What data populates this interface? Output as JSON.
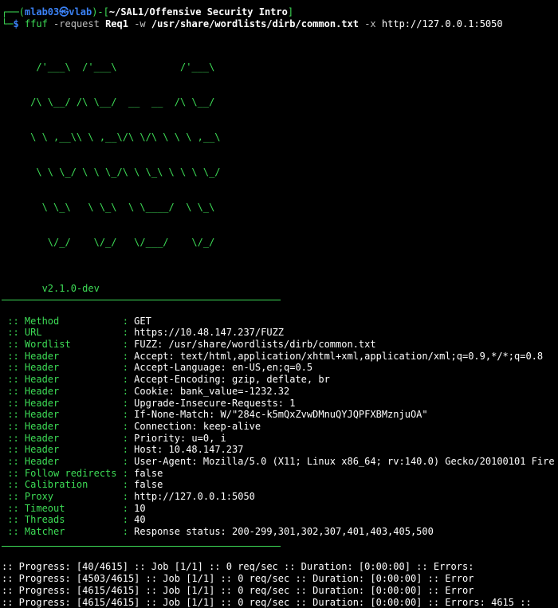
{
  "prompt": {
    "corner_top": "┌──(",
    "user": "mlab03",
    "at": "㉿",
    "host": "vlab",
    "mid": ")-[",
    "path": "~/SAL1/Offensive Security Intro",
    "end": "]",
    "corner_bottom": "└─",
    "dollar": "$"
  },
  "command": {
    "tool": "ffuf",
    "flag_request": " -request ",
    "request_value": "Req1",
    "flag_w": " -w ",
    "wordlist": "/usr/share/wordlists/dirb/common.txt",
    "flag_x": " -x ",
    "proxy": "http://127.0.0.1:5050"
  },
  "banner": [
    "      /'___\\  /'___\\           /'___\\",
    "     /\\ \\__/ /\\ \\__/  __  __  /\\ \\__/",
    "     \\ \\ ,__\\\\ \\ ,__\\/\\ \\/\\ \\ \\ \\ ,__\\",
    "      \\ \\ \\_/ \\ \\ \\_/\\ \\ \\_\\ \\ \\ \\ \\_/",
    "       \\ \\_\\   \\ \\_\\  \\ \\____/  \\ \\_\\",
    "        \\/_/    \\/_/   \\/___/    \\/_/"
  ],
  "version": "       v2.1.0-dev",
  "config": [
    {
      "key": " :: Method           : ",
      "value": "GET"
    },
    {
      "key": " :: URL              : ",
      "value": "https://10.48.147.237/FUZZ"
    },
    {
      "key": " :: Wordlist         : ",
      "value": "FUZZ: /usr/share/wordlists/dirb/common.txt"
    },
    {
      "key": " :: Header           : ",
      "value": "Accept: text/html,application/xhtml+xml,application/xml;q=0.9,*/*;q=0.8"
    },
    {
      "key": " :: Header           : ",
      "value": "Accept-Language: en-US,en;q=0.5"
    },
    {
      "key": " :: Header           : ",
      "value": "Accept-Encoding: gzip, deflate, br"
    },
    {
      "key": " :: Header           : ",
      "value": "Cookie: bank_value=-1232.32"
    },
    {
      "key": " :: Header           : ",
      "value": "Upgrade-Insecure-Requests: 1"
    },
    {
      "key": " :: Header           : ",
      "value": "If-None-Match: W/\"284c-k5mQxZvwDMnuQYJQPFXBMznjuOA\""
    },
    {
      "key": " :: Header           : ",
      "value": "Connection: keep-alive"
    },
    {
      "key": " :: Header           : ",
      "value": "Priority: u=0, i"
    },
    {
      "key": " :: Header           : ",
      "value": "Host: 10.48.147.237"
    },
    {
      "key": " :: Header           : ",
      "value": "User-Agent: Mozilla/5.0 (X11; Linux x86_64; rv:140.0) Gecko/20100101 Fire"
    },
    {
      "key": " :: Follow redirects : ",
      "value": "false"
    },
    {
      "key": " :: Calibration      : ",
      "value": "false"
    },
    {
      "key": " :: Proxy            : ",
      "value": "http://127.0.0.1:5050"
    },
    {
      "key": " :: Timeout          : ",
      "value": "10"
    },
    {
      "key": " :: Threads          : ",
      "value": "40"
    },
    {
      "key": " :: Matcher          : ",
      "value": "Response status: 200-299,301,302,307,401,403,405,500"
    }
  ],
  "progress": [
    ":: Progress: [40/4615] :: Job [1/1] :: 0 req/sec :: Duration: [0:00:00] :: Errors:",
    ":: Progress: [4503/4615] :: Job [1/1] :: 0 req/sec :: Duration: [0:00:00] :: Error",
    ":: Progress: [4615/4615] :: Job [1/1] :: 0 req/sec :: Duration: [0:00:00] :: Error",
    ":: Progress: [4615/4615] :: Job [1/1] :: 0 req/sec :: Duration: [0:00:00] :: Errors: 4615 ::"
  ],
  "colors": {
    "background": "#000000",
    "accent_green": "#3ddc56",
    "prompt_blue": "#3b82f6"
  }
}
